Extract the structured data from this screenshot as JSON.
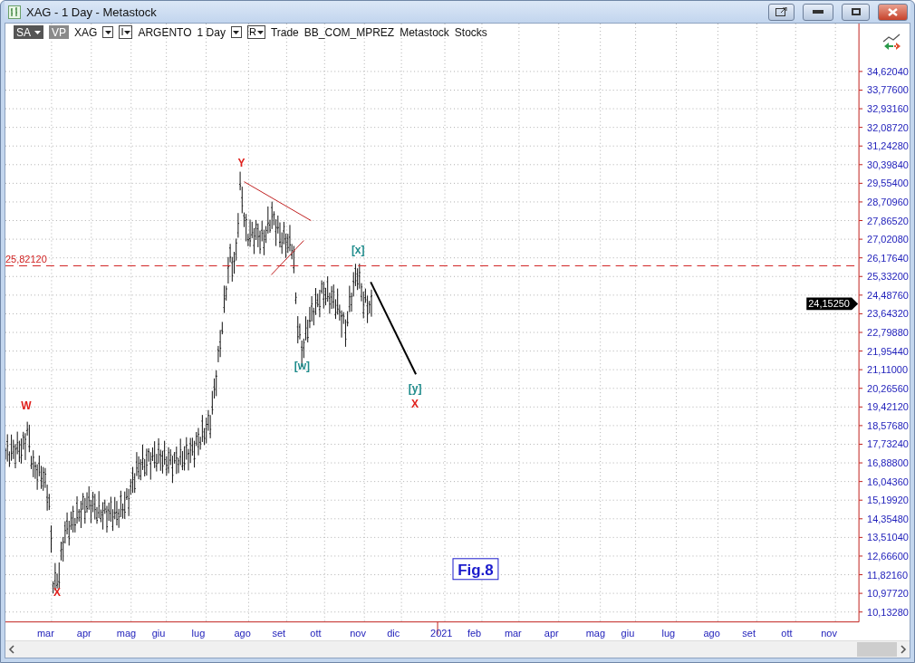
{
  "window": {
    "title": "XAG - 1 Day - Metastock"
  },
  "toolbar": [
    {
      "kind": "badge",
      "label": "SA",
      "dark": true,
      "dropdown": true
    },
    {
      "kind": "badge",
      "label": "VP",
      "dark": false,
      "dropdown": false
    },
    {
      "kind": "text",
      "label": "XAG"
    },
    {
      "kind": "dropdown"
    },
    {
      "kind": "letter",
      "label": "I"
    },
    {
      "kind": "text",
      "label": "ARGENTO"
    },
    {
      "kind": "text",
      "label": "1 Day"
    },
    {
      "kind": "dropdown"
    },
    {
      "kind": "letter",
      "label": "R"
    },
    {
      "kind": "text",
      "label": "Trade"
    },
    {
      "kind": "text",
      "label": "BB_COM_MPREZ"
    },
    {
      "kind": "text",
      "label": "Metastock"
    },
    {
      "kind": "text",
      "label": "Stocks"
    }
  ],
  "chart": {
    "y_axis_labels": [
      "34,62040",
      "33,77600",
      "32,93160",
      "32,08720",
      "31,24280",
      "30,39840",
      "29,55400",
      "28,70960",
      "27,86520",
      "27,02080",
      "26,17640",
      "25,33200",
      "24,48760",
      "23,64320",
      "22,79880",
      "21,95440",
      "21,11000",
      "20,26560",
      "19,42120",
      "18,57680",
      "17,73240",
      "16,88800",
      "16,04360",
      "15,19920",
      "14,35480",
      "13,51040",
      "12,66600",
      "11,82160",
      "10,97720",
      "10,13280"
    ],
    "x_axis_labels": [
      "mar",
      "apr",
      "mag",
      "giu",
      "lug",
      "ago",
      "set",
      "ott",
      "nov",
      "dic",
      "2021",
      "feb",
      "mar",
      "apr",
      "mag",
      "giu",
      "lug",
      "ago",
      "set",
      "ott",
      "nov"
    ],
    "reference_line": {
      "label": "25,82120"
    },
    "last_price": "24,15250",
    "annotations": [
      {
        "text": "W",
        "color": "#e0201c"
      },
      {
        "text": "X",
        "color": "#e0201c"
      },
      {
        "text": "Y",
        "color": "#e0201c"
      },
      {
        "text": "[w]",
        "color": "#1f8c8c"
      },
      {
        "text": "[x]",
        "color": "#1f8c8c"
      },
      {
        "text": "[y]",
        "color": "#1f8c8c"
      },
      {
        "text": "X",
        "color": "#e0201c"
      }
    ],
    "figure_label": "Fig.8"
  }
}
